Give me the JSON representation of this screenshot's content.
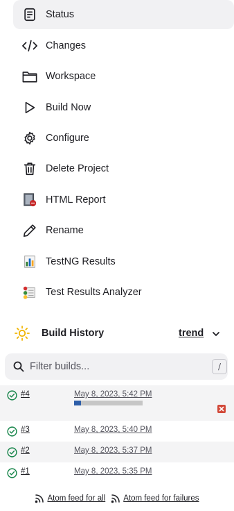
{
  "tasks": [
    {
      "label": "Status",
      "icon": "status-icon",
      "active": true
    },
    {
      "label": "Changes",
      "icon": "code-icon"
    },
    {
      "label": "Workspace",
      "icon": "folder-icon"
    },
    {
      "label": "Build Now",
      "icon": "play-icon"
    },
    {
      "label": "Configure",
      "icon": "gear-icon"
    },
    {
      "label": "Delete Project",
      "icon": "trash-icon"
    },
    {
      "label": "HTML Report",
      "icon": "html-report-icon"
    },
    {
      "label": "Rename",
      "icon": "pencil-icon"
    },
    {
      "label": "TestNG Results",
      "icon": "testng-chart-icon"
    },
    {
      "label": "Test Results Analyzer",
      "icon": "analyzer-icon"
    }
  ],
  "build_history": {
    "title": "Build History",
    "trend_label": "trend",
    "filter_placeholder": "Filter builds...",
    "filter_shortcut": "/",
    "builds": [
      {
        "number": "#4",
        "date": "May 8, 2023, 5:42 PM",
        "status": "success",
        "in_progress": true,
        "progress_percent": 10
      },
      {
        "number": "#3",
        "date": "May 8, 2023, 5:40 PM",
        "status": "success"
      },
      {
        "number": "#2",
        "date": "May 8, 2023, 5:37 PM",
        "status": "success"
      },
      {
        "number": "#1",
        "date": "May 8, 2023, 5:35 PM",
        "status": "success"
      }
    ]
  },
  "feeds": {
    "all_label": "Atom feed for all",
    "failures_label": "Atom feed for failures"
  },
  "colors": {
    "active_bg": "#f1f1f3",
    "success": "#138347",
    "progress_fill": "#2d5ea8",
    "progress_track": "#c6c6c6",
    "cancel": "#d24939",
    "sun": "#f0b400"
  }
}
